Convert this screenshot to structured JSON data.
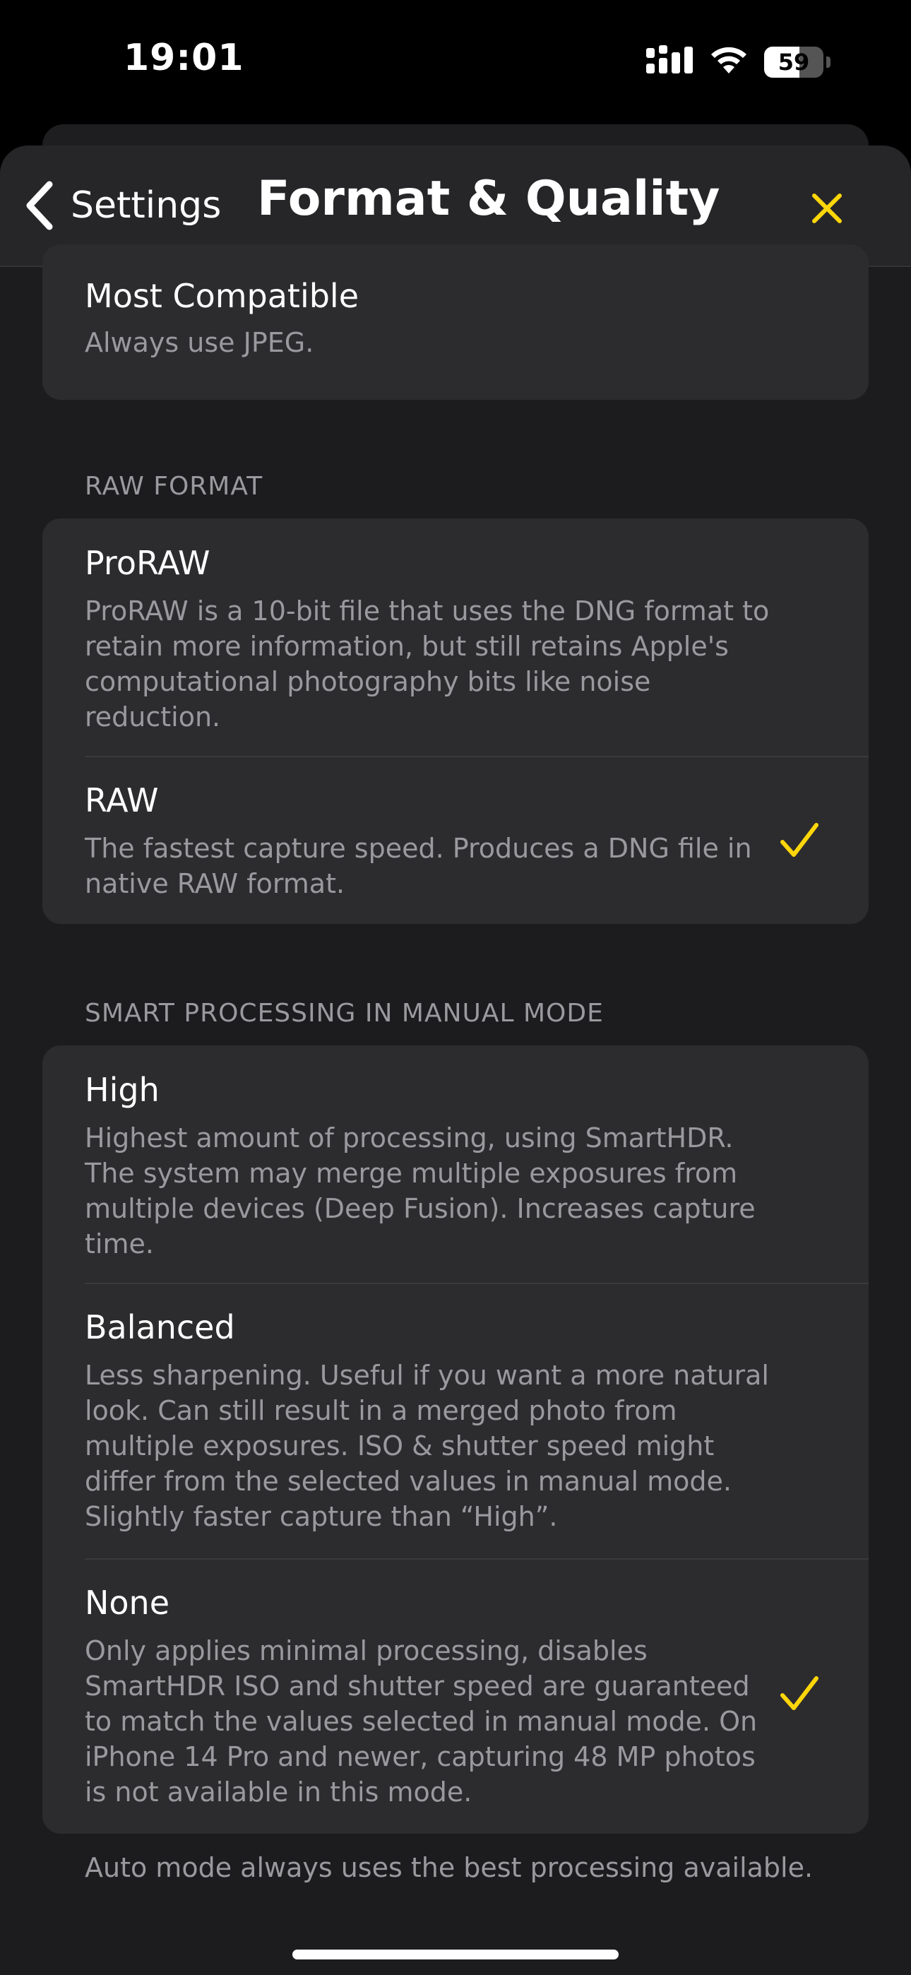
{
  "status_bar": {
    "time": "19:01",
    "battery": "59",
    "battery_level": 0.59
  },
  "nav": {
    "back_label": "Settings",
    "title": "Format & Quality"
  },
  "accent_color": "#ffd60a",
  "format_group": {
    "items": [
      {
        "title": "Most Compatible",
        "desc": "Always use JPEG.",
        "selected": false
      }
    ]
  },
  "raw_section": {
    "header": "RAW FORMAT",
    "items": [
      {
        "title": "ProRAW",
        "desc": "ProRAW is a 10-bit file that uses the DNG format to retain more information, but still retains Apple's computational photography bits like noise reduction.",
        "selected": false
      },
      {
        "title": "RAW",
        "desc": "The fastest capture speed. Produces a DNG file in native RAW format.",
        "selected": true
      }
    ]
  },
  "processing_section": {
    "header": "SMART PROCESSING IN MANUAL MODE",
    "items": [
      {
        "title": "High",
        "desc": "Highest amount of processing, using SmartHDR. The system may merge multiple exposures from multiple devices (Deep Fusion). Increases capture time.",
        "selected": false
      },
      {
        "title": "Balanced",
        "desc": "Less sharpening. Useful if you want a more natural look. Can still result in a merged photo from multiple exposures. ISO & shutter speed might differ from the selected values in manual mode. Slightly faster capture than “High”.",
        "selected": false
      },
      {
        "title": "None",
        "desc": "Only applies minimal processing, disables SmartHDR ISO and shutter speed are guaranteed to match the values selected in manual mode. On iPhone 14 Pro and newer, capturing 48 MP photos is not available in this mode.",
        "selected": true
      }
    ],
    "footer": "Auto mode always uses the best processing available."
  }
}
